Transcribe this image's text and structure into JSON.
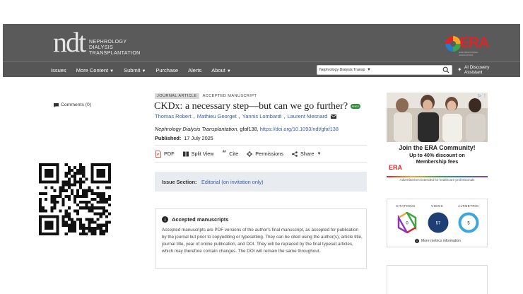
{
  "header": {
    "logo_text": "ndt",
    "logo_sub": [
      "NEPHROLOGY",
      "DIALYSIS",
      "TRANSPLANTATION"
    ],
    "partner_logo": "ERA",
    "partner_tag": "EUROPEAN RENAL ASSOCIATION"
  },
  "nav": {
    "items": [
      {
        "label": "Issues",
        "dropdown": false
      },
      {
        "label": "More Content",
        "dropdown": true
      },
      {
        "label": "Submit",
        "dropdown": true
      },
      {
        "label": "Purchase",
        "dropdown": false
      },
      {
        "label": "Alerts",
        "dropdown": false
      },
      {
        "label": "About",
        "dropdown": true
      }
    ],
    "search_scope": "Nephrology Dialysis Transp",
    "ai_label_1": "AI Discovery",
    "ai_label_2": "Assistant"
  },
  "left": {
    "comments": "Comments (0)"
  },
  "article": {
    "badge_type": "JOURNAL ARTICLE",
    "badge_status": "ACCEPTED MANUSCRIPT",
    "title": "CKDx: a necessary step—but can we go further?",
    "free_label": "FREE",
    "authors": [
      "Thomas Robert",
      "Mathieu Georget",
      "Yannis Lombardi",
      "Laurent Mesnard"
    ],
    "journal": "Nephrology Dialysis Transplantation",
    "article_id": ", gfaf138, ",
    "doi": "https://doi.org/10.1093/ndt/gfaf138",
    "published_label": "Published:",
    "published_date": "17 July 2025",
    "tools": {
      "pdf": "PDF",
      "split": "Split View",
      "cite": "Cite",
      "permissions": "Permissions",
      "share": "Share"
    },
    "issue_section_label": "Issue Section:",
    "issue_section_value": "Editorial (on invitation only)",
    "am_heading": "Accepted manuscripts",
    "am_body": "Accepted manuscripts are PDF versions of the author's final manuscript, as accepted for publication by the journal but prior to copyediting or typesetting. They can be cited using the author(s), article title, journal title, year of online publication, and DOI. They will be replaced by the final typeset articles, which may therefore contain changes. The DOI will remain the same throughout."
  },
  "ad": {
    "headline": "Join the ERA Community!",
    "sub_1": "Up to 40% discount on",
    "sub_2": "Membership fees",
    "logo": "ERA",
    "note": "Advertisement intended for healthcare professionals"
  },
  "metrics": {
    "citations_label": "CITATIONS",
    "citations_value": "0",
    "views_label": "VIEWS",
    "views_value": "57",
    "altmetric_label": "ALTMETRIC",
    "altmetric_value": "5",
    "more_label": "More metrics information"
  },
  "colors": {
    "header_bg": "#5a5a5a",
    "link": "#3a5ca8",
    "era_red": "#d8262c",
    "views_navy": "#1e3f73",
    "altmetric_blue": "#3fa6dc"
  }
}
